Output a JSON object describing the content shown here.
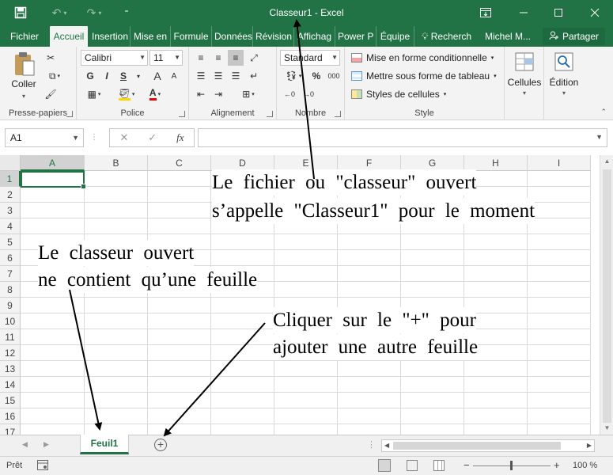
{
  "window": {
    "title": "Classeur1 - Excel",
    "icons": [
      "save-icon",
      "undo-icon",
      "redo-icon",
      "customize-icon",
      "ribbon-display-icon",
      "minimize-icon",
      "maximize-icon",
      "close-icon"
    ]
  },
  "tabs": [
    "Fichier",
    "Accueil",
    "Insertion",
    "Mise en",
    "Formule",
    "Données",
    "Révision",
    "Affichag",
    "Power P",
    "Équipe"
  ],
  "tell_me": "Recherch",
  "user": "Michel M...",
  "share_label": "Partager",
  "ribbon": {
    "clipboard": {
      "paste_label": "Coller",
      "group_label": "Presse-papiers"
    },
    "font": {
      "font_name": "Calibri",
      "font_size": "11",
      "bold": "G",
      "italic": "I",
      "underline": "S",
      "grow": "A",
      "shrink": "A",
      "font_color_letter": "A",
      "group_label": "Police"
    },
    "alignment": {
      "group_label": "Alignement"
    },
    "number": {
      "format": "Standard",
      "percent": "%",
      "thousands": "000",
      "group_label": "Nombre"
    },
    "styles": {
      "conditional": "Mise en forme conditionnelle",
      "table": "Mettre sous forme de tableau",
      "cell_styles": "Styles de cellules",
      "group_label": "Style"
    },
    "cells": {
      "label": "Cellules"
    },
    "editing": {
      "label": "Édition"
    }
  },
  "formula_bar": {
    "name_box": "A1",
    "fx": "fx",
    "value": ""
  },
  "grid": {
    "columns": [
      "A",
      "B",
      "C",
      "D",
      "E",
      "F",
      "G",
      "H",
      "I"
    ],
    "rows": [
      "1",
      "2",
      "3",
      "4",
      "5",
      "6",
      "7",
      "8",
      "9",
      "10",
      "11",
      "12",
      "13",
      "14",
      "15",
      "16",
      "17"
    ],
    "active_cell": "A1"
  },
  "annotations": {
    "file_line1": "Le fichier ou \"classeur\" ouvert",
    "file_line2": "s’appelle \"Classeur1\" pour le moment",
    "sheet_line1": "Le classeur ouvert",
    "sheet_line2": "ne contient qu’une feuille",
    "add_line1": "Cliquer sur le \"+\" pour",
    "add_line2": "ajouter une autre feuille"
  },
  "sheets": {
    "tabs": [
      "Feuil1"
    ],
    "add_label": "+"
  },
  "status": {
    "ready": "Prêt",
    "zoom": "100 %",
    "zoom_minus": "−",
    "zoom_plus": "+"
  },
  "colors": {
    "accent": "#217346",
    "ribbon_bg": "#f3f3f3"
  }
}
